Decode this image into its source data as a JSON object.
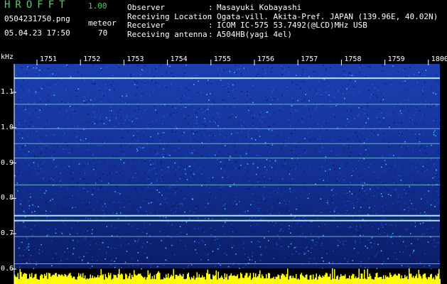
{
  "header": {
    "app_name": "HROFFT",
    "version": "1.00",
    "filename": "0504231750.png",
    "meteor_label": "meteor",
    "datetime": "05.04.23 17:50",
    "meteor_count": "70",
    "info": [
      {
        "key": "Observer",
        "value": "Masayuki Kobayashi"
      },
      {
        "key": "Receiving Location",
        "value": "Ogata-vill. Akita-Pref. JAPAN (139.96E, 40.02N)"
      },
      {
        "key": "Receiver",
        "value": "ICOM IC-575 53.7492(@LCD)MHz USB"
      },
      {
        "key": "Receiving antenna",
        "value": "A504HB(yagi 4el)"
      }
    ],
    "separator": ":"
  },
  "chart_data": {
    "type": "heatmap",
    "ylabel": "kHz",
    "yticks": [
      "1.1",
      "1.0",
      "0.9",
      "0.8",
      "0.7",
      "0.6"
    ],
    "ytick_values": [
      1.1,
      1.0,
      0.9,
      0.8,
      0.7,
      0.6
    ],
    "ylim": [
      0.59,
      1.16
    ],
    "xticks": [
      "1751",
      "1752",
      "1753",
      "1754",
      "1755",
      "1756",
      "1757",
      "1758",
      "1759",
      "1800"
    ],
    "horizontal_lines_khz": [
      1.14,
      1.066,
      0.997,
      0.955,
      0.914,
      0.838,
      0.751,
      0.737,
      0.692,
      0.615
    ],
    "colors": {
      "background": "#000000",
      "noise_dark": "#0a1a66",
      "noise_mid": "#1e46c8",
      "noise_bright": "#3cc8ff",
      "line": "#8fe0f0",
      "amplitude": "#ffff00",
      "header_green": "#4fd06a",
      "text": "#ffffff"
    }
  }
}
